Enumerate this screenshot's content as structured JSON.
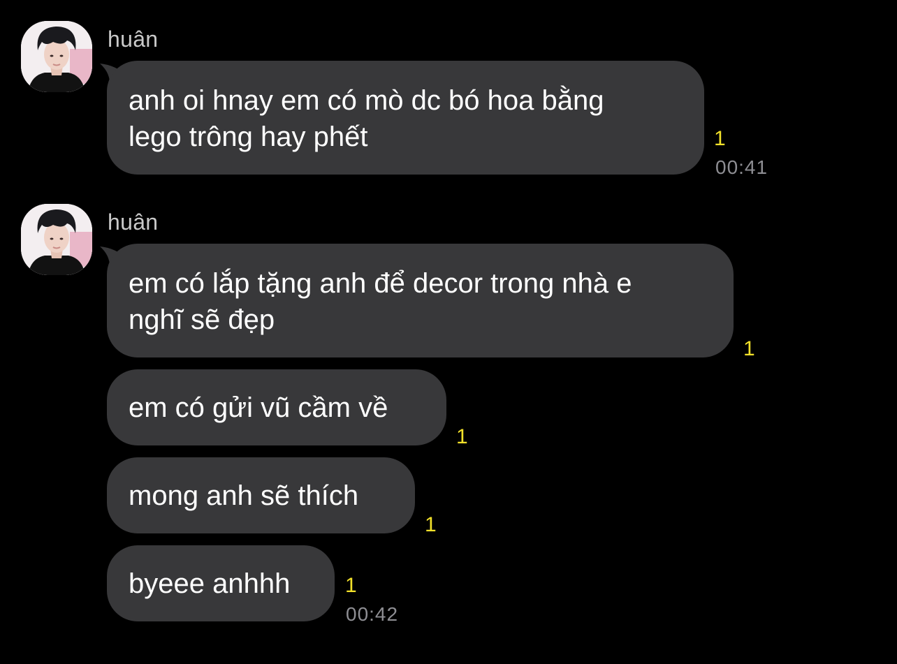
{
  "colors": {
    "background": "#000000",
    "bubble": "#38383a",
    "message_text": "#ffffff",
    "sender_name": "#c9c9c9",
    "unread_indicator": "#f2e12a",
    "timestamp": "#8e8e93"
  },
  "groups": [
    {
      "sender": "huân",
      "avatar_icon": "profile-photo-avatar",
      "messages": [
        {
          "lines": [
            "anh oi hnay em có mò dc bó hoa bằng",
            "lego trông hay phết"
          ],
          "unread": "1",
          "time": "00:41"
        }
      ]
    },
    {
      "sender": "huân",
      "avatar_icon": "profile-photo-avatar",
      "messages": [
        {
          "lines": [
            "em có lắp tặng anh để decor trong nhà e",
            "nghĩ sẽ đẹp"
          ],
          "unread": "1"
        },
        {
          "lines": [
            "em có gửi vũ cầm về"
          ],
          "unread": "1"
        },
        {
          "lines": [
            "mong anh sẽ thích"
          ],
          "unread": "1"
        },
        {
          "lines": [
            "byeee anhhh"
          ],
          "unread": "1",
          "time": "00:42"
        }
      ]
    }
  ]
}
